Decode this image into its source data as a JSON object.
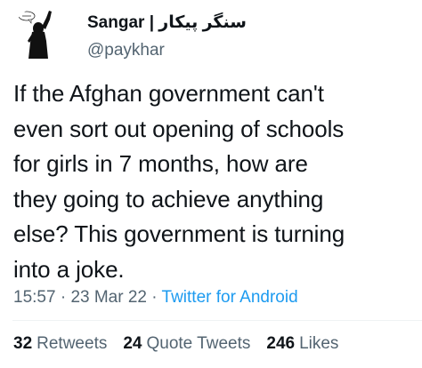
{
  "author": {
    "display_name": "Sangar | سنگر پیکار",
    "handle": "@paykhar",
    "avatar_icon": "protester-silhouette-avatar"
  },
  "tweet": {
    "text": "If the Afghan government can't\neven sort out opening of schools\nfor girls in 7 months, how are\nthey going to achieve anything\nelse? This government is turning\ninto a joke.",
    "time": "15:57",
    "date": "23 Mar 22",
    "separator": "·",
    "source": "Twitter for Android"
  },
  "stats": {
    "retweets_count": "32",
    "retweets_label": "Retweets",
    "quote_tweets_count": "24",
    "quote_tweets_label": "Quote Tweets",
    "likes_count": "246",
    "likes_label": "Likes"
  },
  "colors": {
    "text_primary": "#0f1419",
    "text_secondary": "#536471",
    "link": "#1d9bf0",
    "divider": "#eff3f4"
  }
}
